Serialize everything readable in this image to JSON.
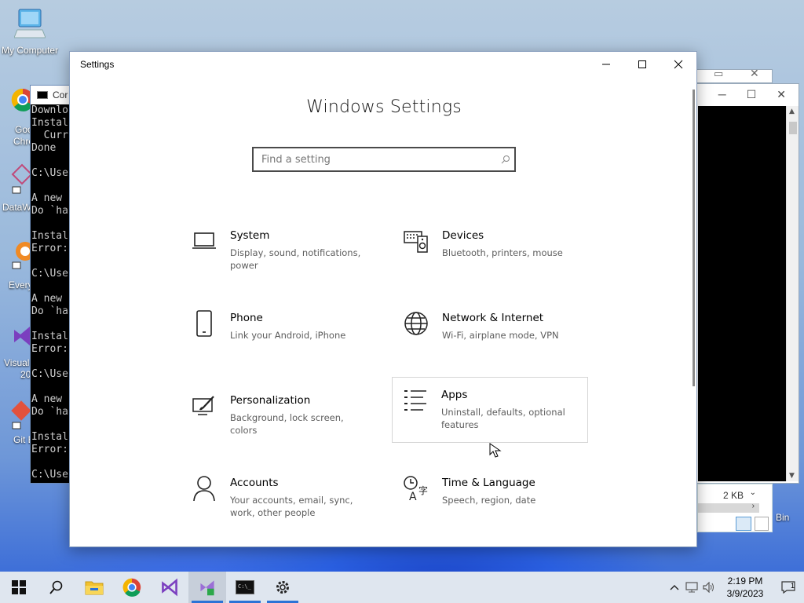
{
  "desktop": {
    "icons": [
      {
        "label": "My Computer",
        "icon": "computer-icon"
      }
    ],
    "partial_labels": [
      "Goo",
      "Chro",
      "DataW",
      "Every",
      "Visual",
      "20",
      "Git B",
      "Bin"
    ]
  },
  "console": {
    "title": "Cor",
    "lines": [
      "Downlo",
      "Instal",
      "  Curr",
      "Done",
      "",
      "C:\\Use",
      "",
      "A new",
      "Do `ha",
      "",
      "Instal",
      "Error:",
      "",
      "C:\\Use",
      "",
      "A new",
      "Do `ha",
      "",
      "Instal",
      "Error:",
      "",
      "C:\\Use",
      "",
      "A new",
      "Do `ha",
      "",
      "Instal",
      "Error:",
      "",
      "C:\\Use"
    ]
  },
  "explorer": {
    "size_text": "2 KB"
  },
  "settings": {
    "window_title": "Settings",
    "heading": "Windows Settings",
    "search_placeholder": "Find a setting",
    "tiles": [
      {
        "name": "System",
        "desc": "Display, sound, notifications, power",
        "icon": "laptop-icon"
      },
      {
        "name": "Devices",
        "desc": "Bluetooth, printers, mouse",
        "icon": "keyboard-speaker-icon"
      },
      {
        "name": "Phone",
        "desc": "Link your Android, iPhone",
        "icon": "phone-icon"
      },
      {
        "name": "Network & Internet",
        "desc": "Wi-Fi, airplane mode, VPN",
        "icon": "globe-icon"
      },
      {
        "name": "Personalization",
        "desc": "Background, lock screen, colors",
        "icon": "paintbrush-icon"
      },
      {
        "name": "Apps",
        "desc": "Uninstall, defaults, optional features",
        "icon": "apps-list-icon"
      },
      {
        "name": "Accounts",
        "desc": "Your accounts, email, sync, work, other people",
        "icon": "person-icon"
      },
      {
        "name": "Time & Language",
        "desc": "Speech, region, date",
        "icon": "time-language-icon"
      }
    ]
  },
  "taskbar": {
    "apps": [
      "start-icon",
      "search-icon",
      "file-explorer-icon",
      "chrome-icon",
      "visual-studio-icon",
      "vs-installer-icon",
      "terminal-icon",
      "settings-gear-icon"
    ],
    "time": "2:19 PM",
    "date": "3/9/2023",
    "notification_count": "1"
  }
}
